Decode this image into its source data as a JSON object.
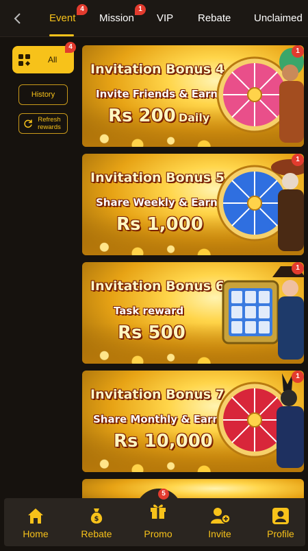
{
  "tabs": [
    {
      "label": "Event",
      "badge": "4",
      "active": true
    },
    {
      "label": "Mission",
      "badge": "1"
    },
    {
      "label": "VIP"
    },
    {
      "label": "Rebate"
    },
    {
      "label": "Unclaimed"
    }
  ],
  "sidebar": {
    "all_label": "All",
    "all_badge": "4",
    "history_label": "History",
    "refresh_label": "Refresh rewards"
  },
  "banners": [
    {
      "title": "Invitation Bonus 4",
      "subtitle": "Invite Friends & Earn",
      "amount": "Rs 200",
      "amount_suffix": "Daily",
      "badge": "1",
      "wheel_color": "#e94f8a"
    },
    {
      "title": "Invitation Bonus 5",
      "subtitle": "Share Weekly & Earn",
      "amount": "Rs 1,000",
      "amount_suffix": "",
      "badge": "1",
      "wheel_color": "#2f6fe0"
    },
    {
      "title": "Invitation Bonus 6",
      "subtitle": "Task reward",
      "amount": "Rs 500",
      "amount_suffix": "",
      "badge": "1",
      "wheel_color": "#3a7be0"
    },
    {
      "title": "Invitation Bonus 7",
      "subtitle": "Share Monthly & Earn",
      "amount": "Rs 10,000",
      "amount_suffix": "",
      "badge": "1",
      "wheel_color": "#d8263a"
    }
  ],
  "bottom_nav": [
    {
      "label": "Home",
      "icon": "home-icon"
    },
    {
      "label": "Rebate",
      "icon": "money-bag-icon"
    },
    {
      "label": "Promo",
      "icon": "gift-icon",
      "badge": "5"
    },
    {
      "label": "Invite",
      "icon": "invite-user-icon"
    },
    {
      "label": "Profile",
      "icon": "profile-icon"
    }
  ],
  "colors": {
    "accent": "#f7c21a",
    "badge": "#e23b2e",
    "background": "#16120e",
    "nav_bg": "#2a2520"
  }
}
